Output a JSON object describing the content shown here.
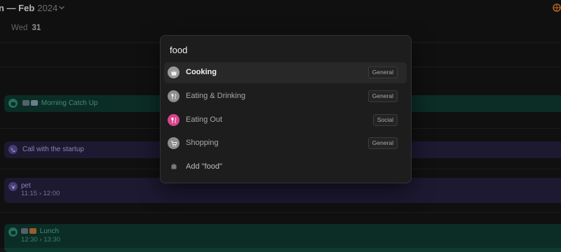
{
  "header": {
    "month": "n — Feb",
    "year": "2024"
  },
  "day": {
    "name": "Wed",
    "number": "31"
  },
  "events": {
    "morning": {
      "title": "Morning Catch Up"
    },
    "call": {
      "title": "Call with the startup"
    },
    "pet": {
      "title": "pet",
      "time": "11:15 › 12:00"
    },
    "lunch": {
      "title": "Lunch",
      "time": "12:30 › 13:30"
    }
  },
  "palette": {
    "query": "food",
    "results": [
      {
        "label": "Cooking",
        "badge": "General",
        "icon": "cooking-pot-icon",
        "color": "#9a9a9a"
      },
      {
        "label": "Eating & Drinking",
        "badge": "General",
        "icon": "fork-knife-icon",
        "color": "#8d8d8d"
      },
      {
        "label": "Eating Out",
        "badge": "Social",
        "icon": "fork-knife-icon",
        "color": "#d9438b"
      },
      {
        "label": "Shopping",
        "badge": "General",
        "icon": "cart-icon",
        "color": "#8d8d8d"
      }
    ],
    "add_label": "Add \"food\""
  },
  "colors": {
    "green_event": "#0f3a30",
    "purple_event": "#24203f",
    "accent_orange": "#e07a2e"
  }
}
